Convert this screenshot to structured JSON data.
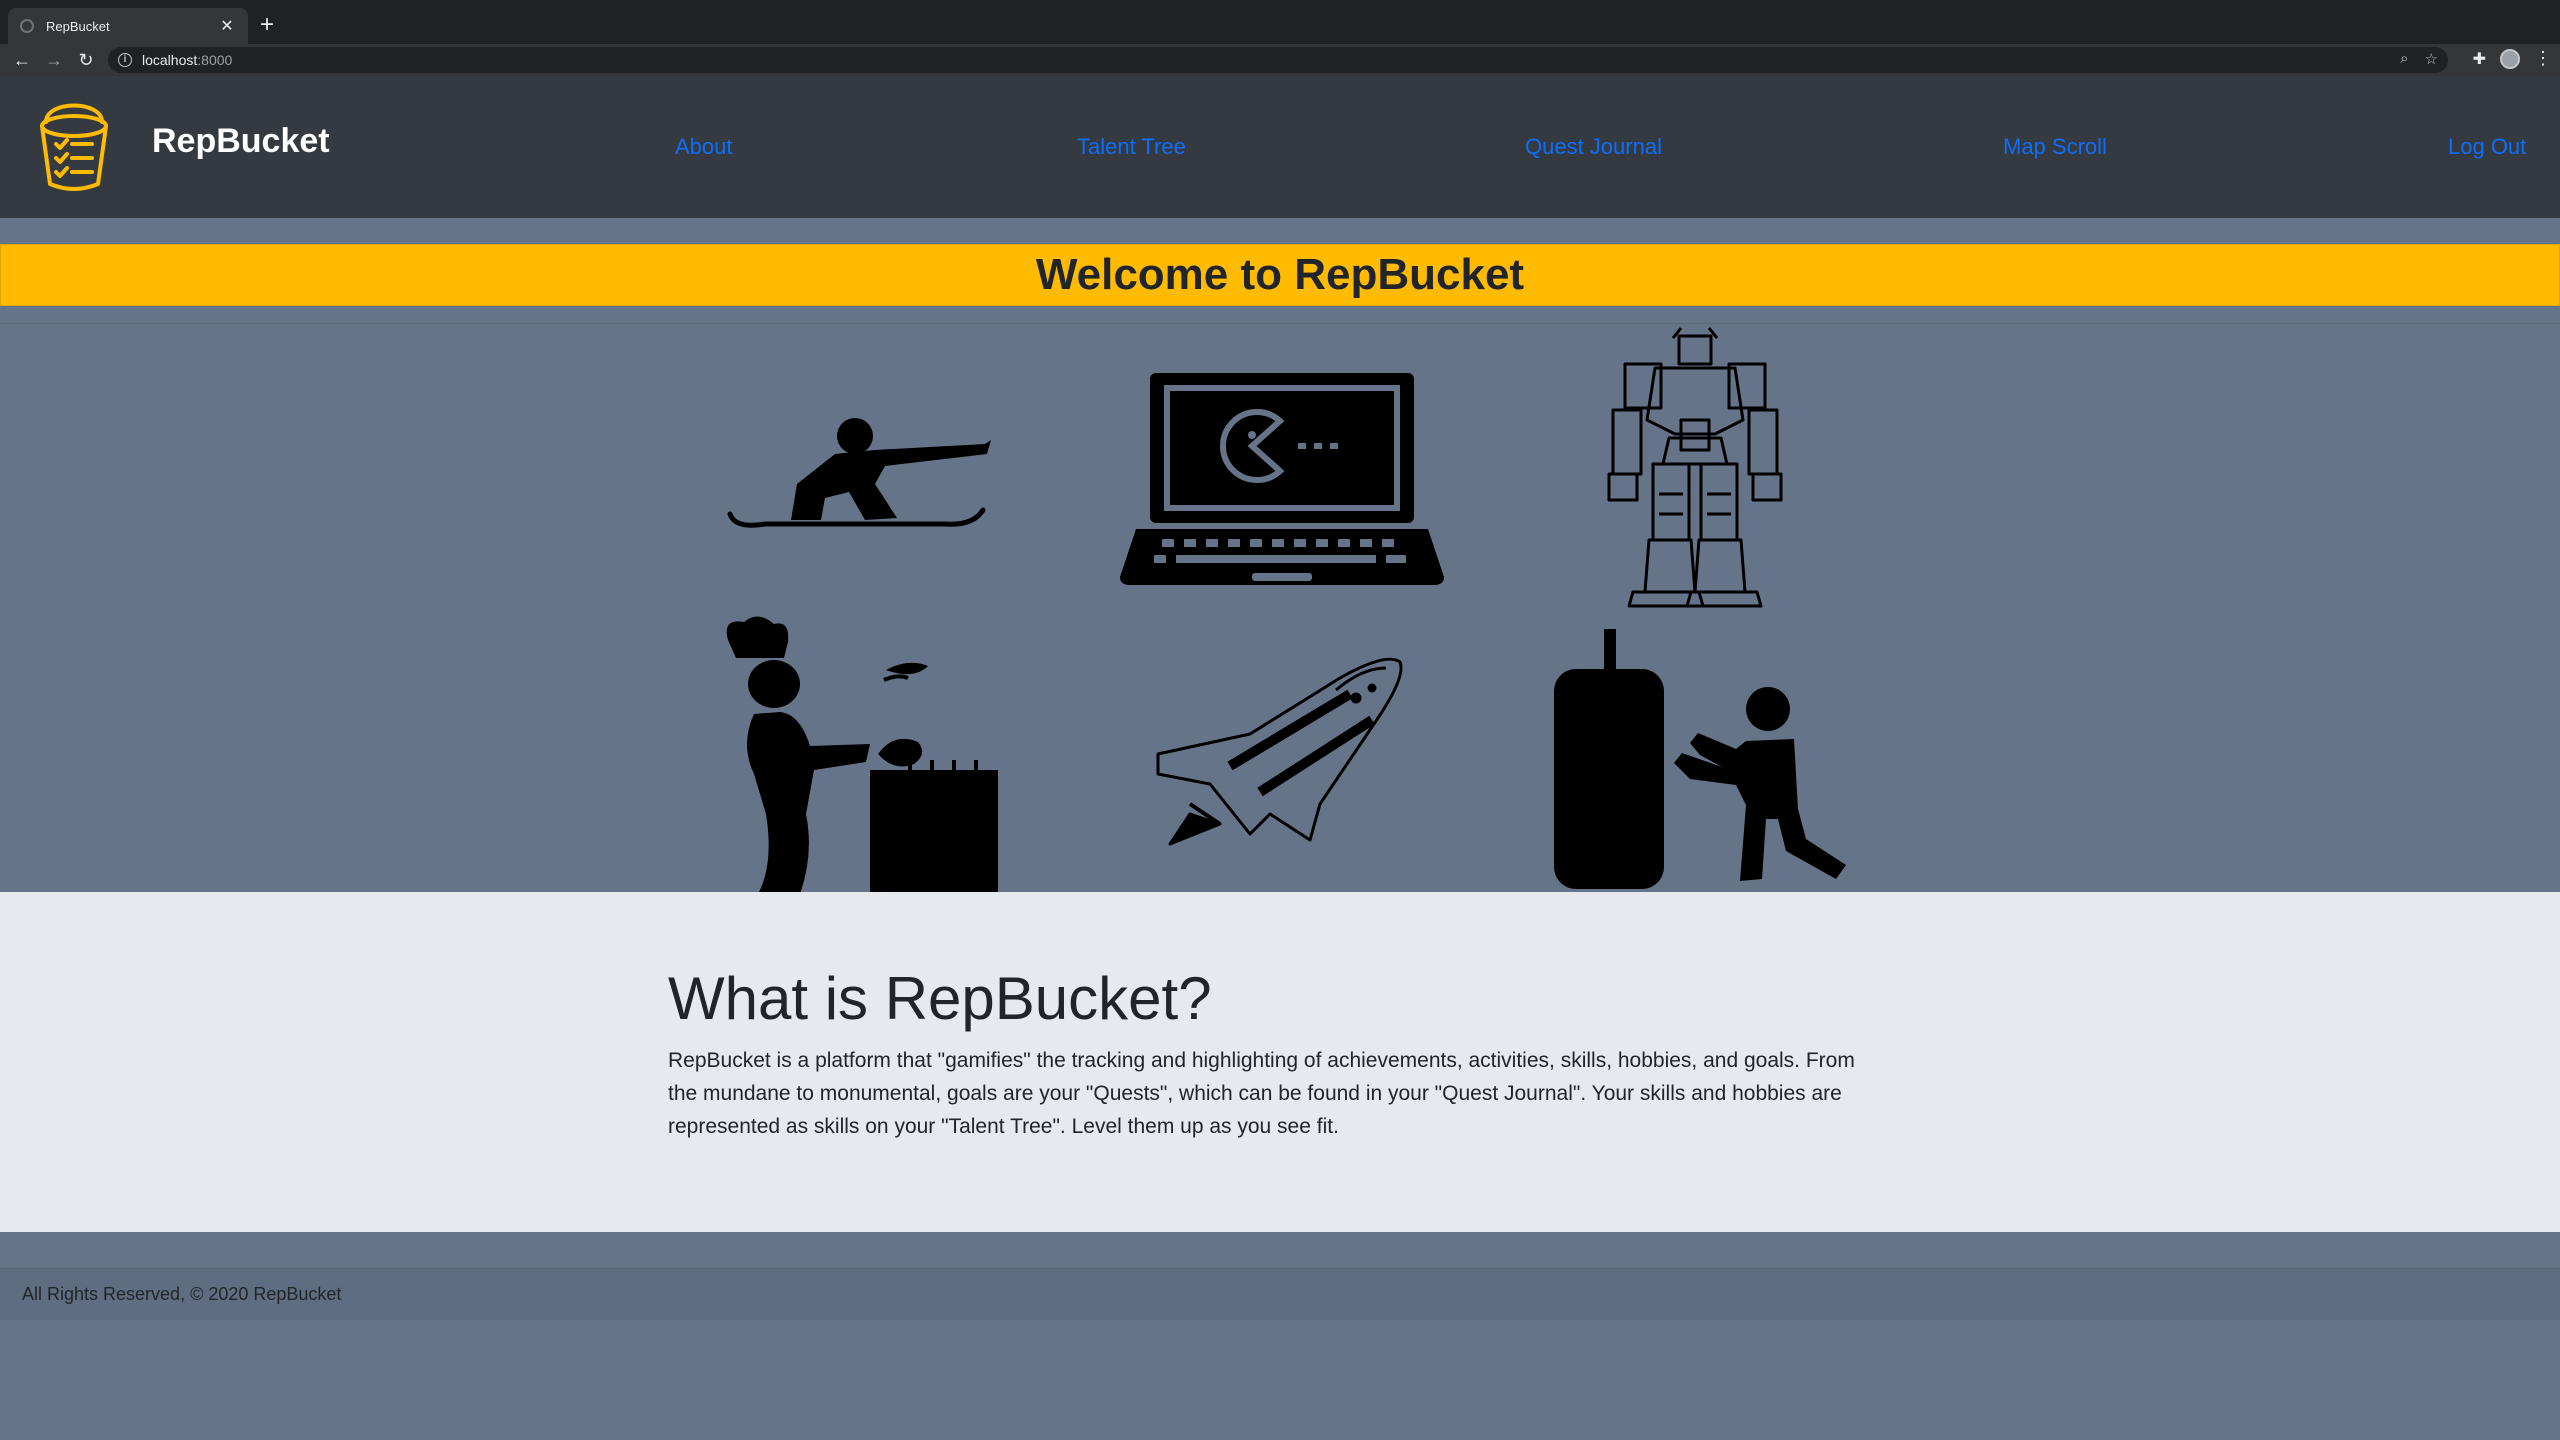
{
  "browser": {
    "tab_title": "RepBucket",
    "url_host": "localhost",
    "url_port": ":8000"
  },
  "site": {
    "brand": "RepBucket",
    "nav": [
      {
        "label": "About"
      },
      {
        "label": "Talent Tree"
      },
      {
        "label": "Quest Journal"
      },
      {
        "label": "Map Scroll"
      },
      {
        "label": "Log Out"
      }
    ],
    "brand_color": "#ffbb00",
    "link_color": "#0d6efd"
  },
  "banner": {
    "title": "Welcome to RepBucket"
  },
  "hero_icons": [
    "snowboarder-icon",
    "laptop-pacman-icon",
    "robot-mech-icon",
    "chef-cooking-icon",
    "space-shuttle-icon",
    "punching-bag-boxer-icon"
  ],
  "about": {
    "heading": "What is RepBucket?",
    "body": "RepBucket is a platform that \"gamifies\" the tracking and highlighting of achievements, activities, skills, hobbies, and goals. From the mundane to monumental, goals are your \"Quests\", which can be found in your \"Quest Journal\". Your skills and hobbies are represented as skills on your \"Talent Tree\". Level them up as you see fit."
  },
  "footer": {
    "text": "All Rights Reserved, © 2020 RepBucket"
  }
}
